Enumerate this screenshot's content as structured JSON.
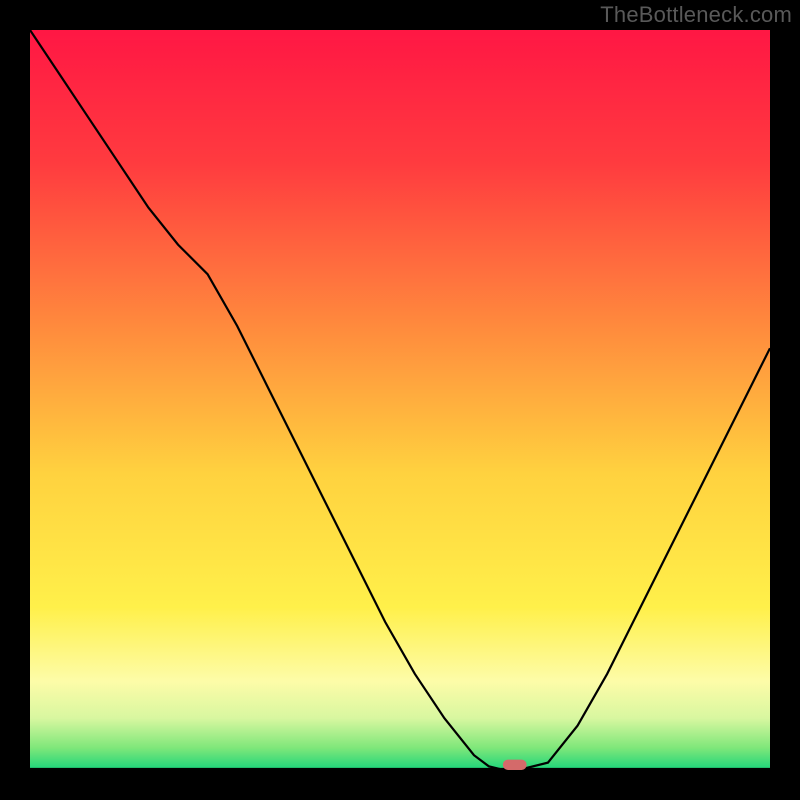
{
  "watermark": "TheBottleneck.com",
  "colors": {
    "frame_background": "#000000",
    "curve_stroke": "#000000",
    "marker_fill": "#d46a6a",
    "watermark_text": "#595959",
    "gradient_stops": [
      {
        "offset": 0.0,
        "color": "#ff1744"
      },
      {
        "offset": 0.18,
        "color": "#ff3b3f"
      },
      {
        "offset": 0.4,
        "color": "#ff8a3d"
      },
      {
        "offset": 0.6,
        "color": "#ffd23f"
      },
      {
        "offset": 0.78,
        "color": "#fff04a"
      },
      {
        "offset": 0.88,
        "color": "#fdfca8"
      },
      {
        "offset": 0.93,
        "color": "#d8f7a0"
      },
      {
        "offset": 0.97,
        "color": "#7fe77a"
      },
      {
        "offset": 1.0,
        "color": "#1bd47a"
      }
    ]
  },
  "chart_data": {
    "type": "line",
    "title": "",
    "xlabel": "",
    "ylabel": "",
    "xlim": [
      0,
      100
    ],
    "ylim": [
      0,
      100
    ],
    "x": [
      0,
      4,
      8,
      12,
      16,
      20,
      24,
      28,
      32,
      36,
      40,
      44,
      48,
      52,
      56,
      60,
      62,
      64,
      66,
      70,
      74,
      78,
      82,
      86,
      90,
      94,
      98,
      100
    ],
    "values": [
      100,
      94,
      88,
      82,
      76,
      71,
      67,
      60,
      52,
      44,
      36,
      28,
      20,
      13,
      7,
      2,
      0.5,
      0,
      0,
      1,
      6,
      13,
      21,
      29,
      37,
      45,
      53,
      57
    ],
    "marker": {
      "x_center": 65.5,
      "y": 0,
      "half_width_x": 1.6,
      "height_y": 1.4
    },
    "legend": null,
    "grid": false
  }
}
